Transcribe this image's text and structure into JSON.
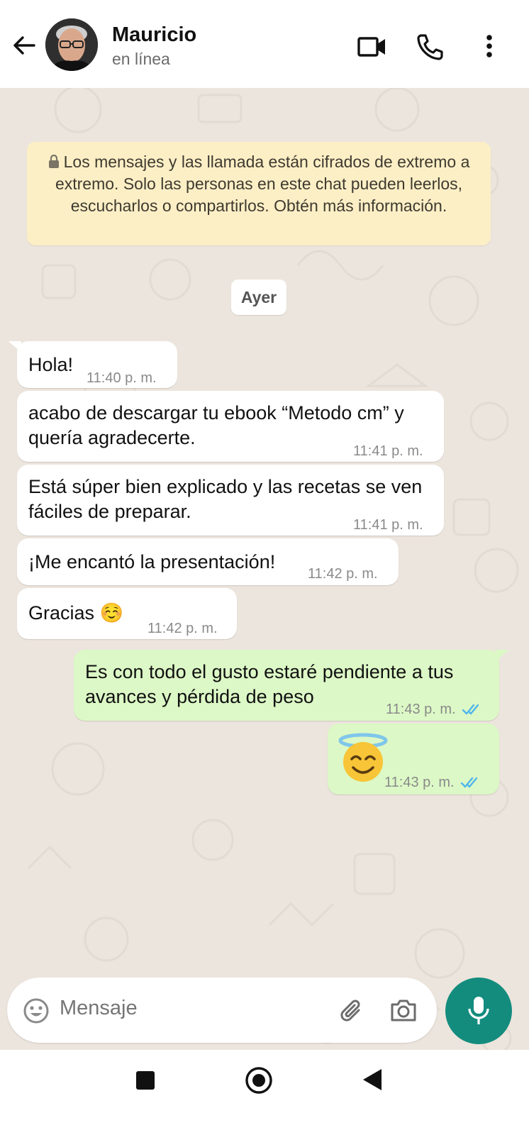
{
  "contact": {
    "name": "Mauricio",
    "status": "en línea"
  },
  "header_icons": [
    "back-arrow-icon",
    "video-call-icon",
    "phone-icon",
    "more-vert-icon"
  ],
  "encryption_notice": "Los mensajes y las llamada están cifrados de extremo a extremo. Solo las personas en este chat pueden leerlos, escucharlos o compartirlos. Obtén más información.",
  "date_chip": "Ayer",
  "messages": [
    {
      "direction": "in",
      "text": "Hola!",
      "time": "11:40 p. m."
    },
    {
      "direction": "in",
      "text": "acabo de descargar tu ebook “Metodo cm” y quería agradecerte.",
      "time": "11:41 p. m."
    },
    {
      "direction": "in",
      "text": "Está súper bien explicado y las recetas se ven fáciles de preparar.",
      "time": "11:41 p. m."
    },
    {
      "direction": "in",
      "text": "¡Me encantó la presentación!",
      "time": "11:42 p. m."
    },
    {
      "direction": "in",
      "text": "Gracias ☺️",
      "time": "11:42 p. m."
    },
    {
      "direction": "out",
      "text": "Es con todo el gusto estaré pendiente a tus avances y pérdida de peso",
      "time": "11:43 p. m.",
      "status": "read"
    },
    {
      "direction": "out",
      "text": "😇",
      "time": "11:43 p. m.",
      "status": "read"
    }
  ],
  "composer": {
    "placeholder": "Mensaje"
  },
  "colors": {
    "incoming_bubble": "#ffffff",
    "outgoing_bubble": "#dcf8c6",
    "read_ticks": "#4fb6ec",
    "mic_button": "#138c7e",
    "notice_bg": "#fcefc6",
    "chat_bg": "#ece5dd"
  }
}
